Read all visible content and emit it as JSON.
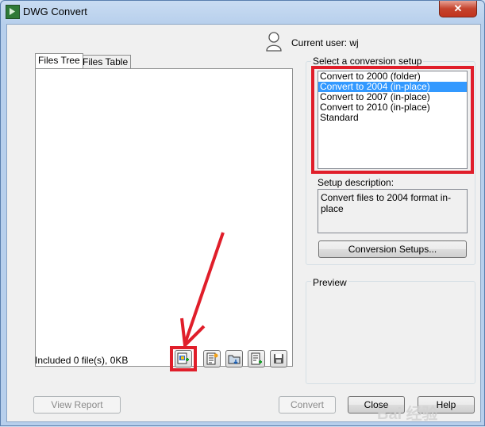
{
  "window": {
    "title": "DWG Convert",
    "close_symbol": "✕"
  },
  "user": {
    "label": "Current user: wj"
  },
  "tabs": [
    {
      "label": "Files Tree"
    },
    {
      "label": "Files Table"
    }
  ],
  "files": {
    "status": "Included 0 file(s), 0KB"
  },
  "setup": {
    "group_label": "Select a conversion setup",
    "options": [
      "Convert to 2000 (folder)",
      "Convert to 2004 (in-place)",
      "Convert to 2007 (in-place)",
      "Convert to 2010 (in-place)",
      "Standard"
    ],
    "selected_index": 1,
    "description_label": "Setup description:",
    "description": "Convert files to 2004 format in-place",
    "setups_button": "Conversion Setups..."
  },
  "preview": {
    "label": "Preview"
  },
  "buttons": {
    "view_report": "View Report",
    "convert": "Convert",
    "close": "Close",
    "help": "Help"
  },
  "watermark": {
    "text": "Bai 经验"
  },
  "colors": {
    "highlight": "#e01e2a",
    "selection": "#3399ff"
  },
  "toolbar_icons": [
    "add-drawing-icon",
    "add-sheet-list-icon",
    "add-folder-icon",
    "add-list-icon",
    "save-list-icon"
  ]
}
